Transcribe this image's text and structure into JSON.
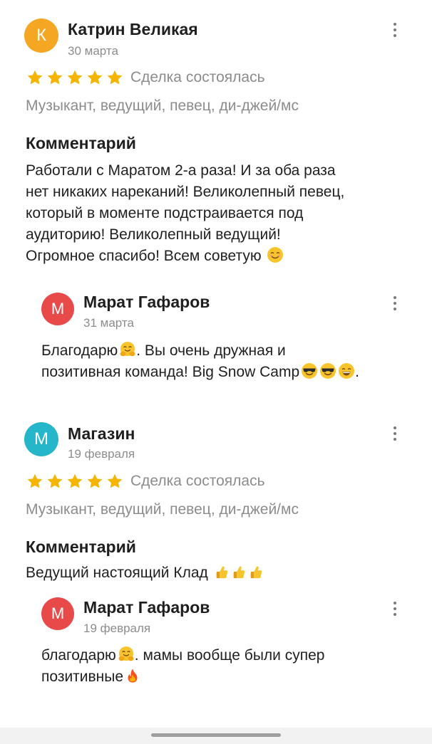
{
  "reviews": [
    {
      "avatar_letter": "К",
      "avatar_color": "#f5a623",
      "author": "Катрин Великая",
      "date": "30 марта",
      "rating": 5,
      "status": "Сделка состоялась",
      "category": "Музыкант, ведущий, певец, ди-джей/мс",
      "comment_heading": "Комментарий",
      "comment_lines": [
        "Работали с Маратом 2-а раза! И за оба раза",
        "нет никаких нареканий! Великолепный певец,",
        "который в моменте подстраивается под",
        "аудиторию! Великолепный ведущий!",
        "Огромное спасибо! Всем советую"
      ],
      "reply": {
        "avatar_letter": "М",
        "avatar_color": "#e84a4a",
        "author": "Марат Гафаров",
        "date": "31 марта",
        "text_lines": [
          "Благодарю",
          ". Вы очень дружная и",
          "позитивная команда! Big Snow Camp",
          "."
        ]
      }
    },
    {
      "avatar_letter": "М",
      "avatar_color": "#25b6c9",
      "author": "Магазин",
      "date": "19 февраля",
      "rating": 5,
      "status": "Сделка состоялась",
      "category": "Музыкант, ведущий, певец, ди-джей/мс",
      "comment_heading": "Комментарий",
      "comment_lines": [
        "Ведущий настоящий Клад"
      ],
      "reply": {
        "avatar_letter": "М",
        "avatar_color": "#e84a4a",
        "author": "Марат Гафаров",
        "date": "19 февраля",
        "text_lines": [
          "благодарю",
          ". мамы вообще были супер",
          "позитивные"
        ]
      }
    }
  ],
  "icons": {
    "star": "star-icon",
    "more": "more-vertical-icon",
    "smile": "smiling-face-icon",
    "hug": "hugging-face-icon",
    "sunglasses": "sunglasses-face-icon",
    "grin": "grinning-face-icon",
    "thumbs_up": "thumbs-up-icon",
    "fire": "fire-icon"
  },
  "colors": {
    "star": "#f5b400",
    "muted_text": "#8c8c8c"
  }
}
